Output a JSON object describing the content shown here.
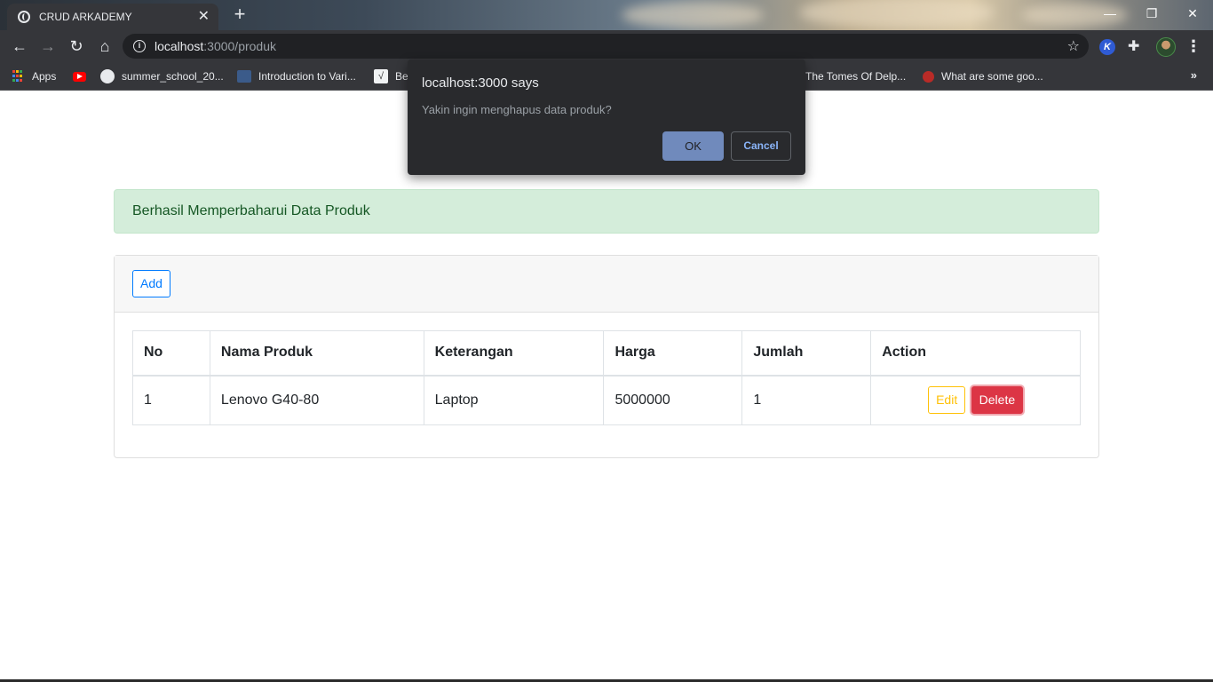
{
  "browser": {
    "tab_title": "CRUD ARKADEMY",
    "tab_close": "✕",
    "new_tab": "+",
    "url_host": "localhost",
    "url_path": ":3000/produk",
    "window_controls": {
      "minimize": "—",
      "restore": "❐",
      "close": "✕"
    },
    "extension_letter": "K",
    "bookmarks": [
      {
        "label": "Apps",
        "icon": "apps-grid-icon"
      },
      {
        "label": "",
        "icon": "youtube-icon"
      },
      {
        "label": "summer_school_20...",
        "icon": "github-icon"
      },
      {
        "label": "Introduction to Vari...",
        "icon": "doc-icon"
      },
      {
        "label": "Be",
        "icon": "chart-icon"
      },
      {
        "label": "The Tomes Of Delp...",
        "icon": "page-icon"
      },
      {
        "label": "What are some goo...",
        "icon": "quora-icon"
      }
    ],
    "bookmarks_more": "»"
  },
  "dialog": {
    "title": "localhost:3000 says",
    "message": "Yakin ingin menghapus data produk?",
    "ok_label": "OK",
    "cancel_label": "Cancel"
  },
  "alert": {
    "message": "Berhasil Memperbaharui Data Produk"
  },
  "card": {
    "add_label": "Add"
  },
  "table": {
    "headers": [
      "No",
      "Nama Produk",
      "Keterangan",
      "Harga",
      "Jumlah",
      "Action"
    ],
    "rows": [
      {
        "no": "1",
        "nama": "Lenovo G40-80",
        "keterangan": "Laptop",
        "harga": "5000000",
        "jumlah": "1",
        "edit_label": "Edit",
        "delete_label": "Delete"
      }
    ]
  },
  "colors": {
    "alert_bg": "#d4edda",
    "alert_text": "#155724",
    "primary": "#007bff",
    "warning": "#ffc107",
    "danger": "#dc3545",
    "dialog_bg": "#292a2d"
  }
}
